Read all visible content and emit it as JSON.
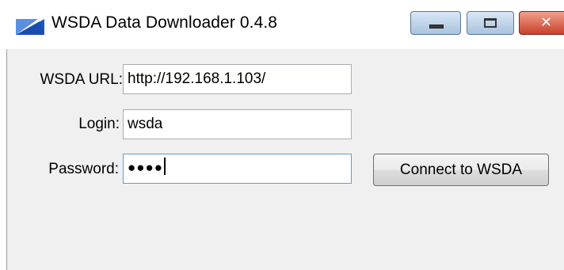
{
  "window": {
    "title": "WSDA Data Downloader 0.4.8",
    "controls": {
      "minimize": "minimize",
      "maximize": "maximize",
      "close": "close"
    },
    "close_glyph": "✕"
  },
  "form": {
    "url_label": "WSDA URL:",
    "url_value": "http://192.168.1.103/",
    "login_label": "Login:",
    "login_value": "wsda",
    "password_label": "Password:",
    "password_masked": "●●●●",
    "connect_button": "Connect to WSDA"
  },
  "icons": {
    "app": "app-icon",
    "minimize": "minimize-icon",
    "maximize": "maximize-icon",
    "close": "close-icon"
  },
  "colors": {
    "title_text": "#000000",
    "client_bg": "#f0f0f0",
    "close_button": "#c8402b",
    "focus_border": "#5c9cd6",
    "app_icon": "#1e56c3"
  }
}
